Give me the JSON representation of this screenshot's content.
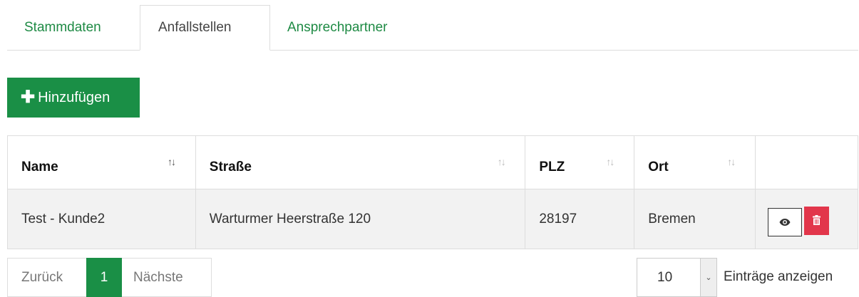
{
  "tabs": [
    {
      "label": "Stammdaten",
      "active": false
    },
    {
      "label": "Anfallstellen",
      "active": true
    },
    {
      "label": "Ansprechpartner",
      "active": false
    }
  ],
  "add_button": {
    "label": "Hinzufügen",
    "icon": "plus-icon"
  },
  "table": {
    "headers": [
      {
        "label": "Name",
        "sort_icon": "↑↓"
      },
      {
        "label": "Straße",
        "sort_icon": "↑↓"
      },
      {
        "label": "PLZ",
        "sort_icon": "↑↓"
      },
      {
        "label": "Ort",
        "sort_icon": "↑↓"
      }
    ],
    "rows": [
      {
        "name": "Test - Kunde2",
        "strasse": "Warturmer Heerstraße 120",
        "plz": "28197",
        "ort": "Bremen"
      }
    ]
  },
  "pagination": {
    "prev": "Zurück",
    "current": "1",
    "next": "Nächste"
  },
  "page_size": {
    "value": "10",
    "label": "Einträge anzeigen"
  },
  "colors": {
    "accent": "#1a8f46",
    "danger": "#e2364b",
    "link": "#1e8a44"
  }
}
